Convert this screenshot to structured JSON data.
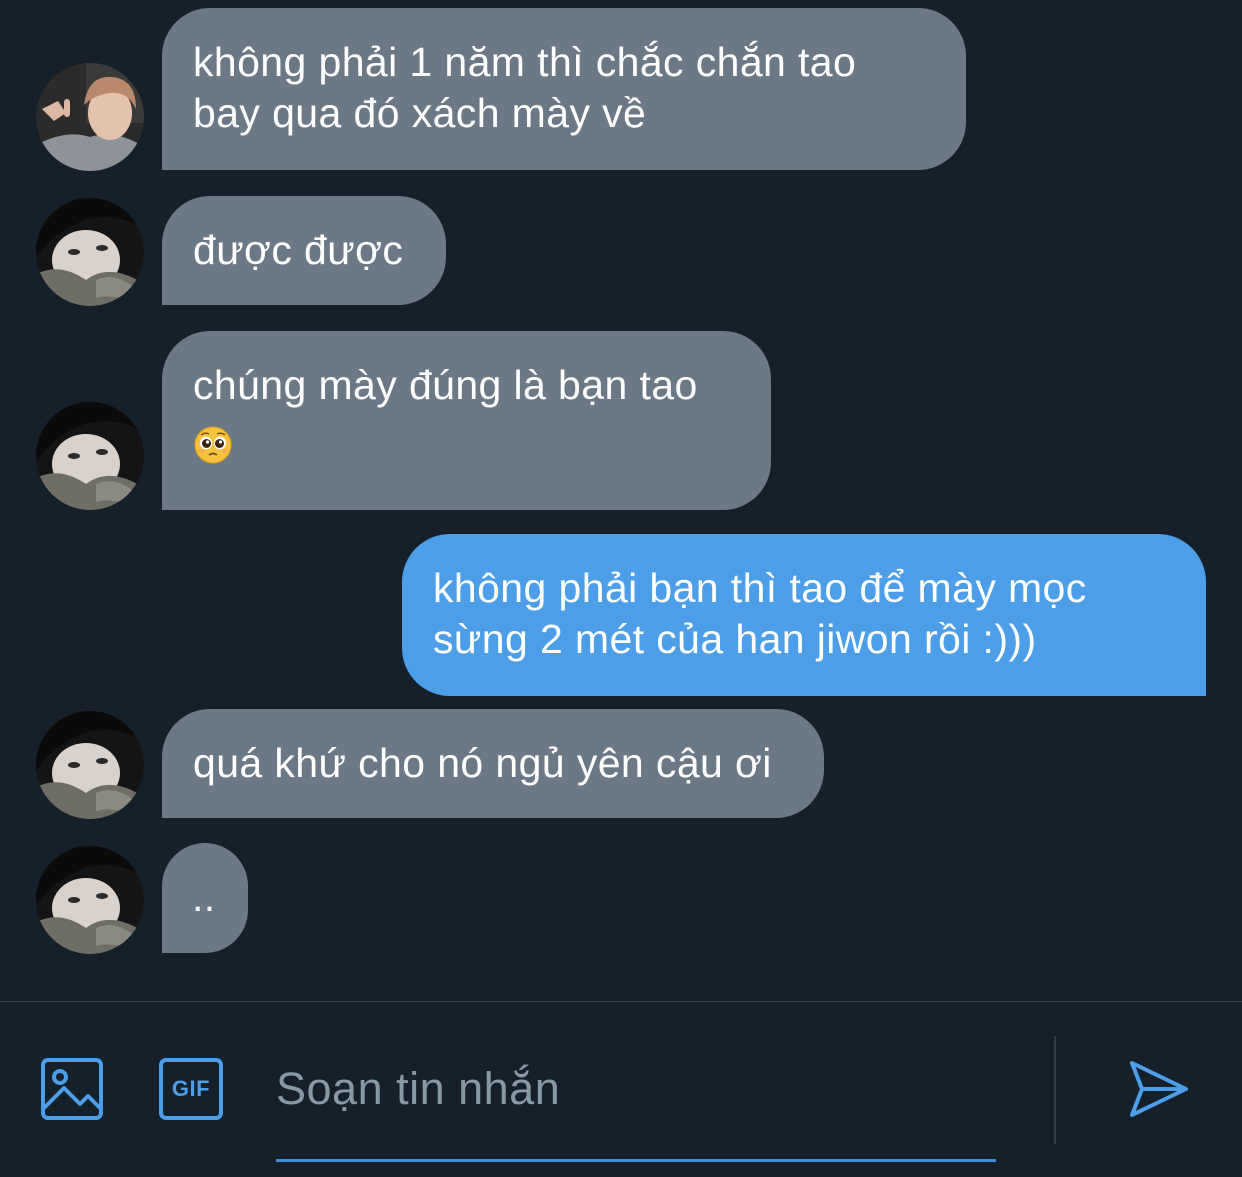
{
  "colors": {
    "background": "#15202b",
    "incoming_bubble": "#6b7885",
    "outgoing_bubble": "#4c9ee8",
    "accent": "#4c9ee8",
    "placeholder": "#8899a6"
  },
  "messages": [
    {
      "sender": "other",
      "avatar": "avatar-light-hair",
      "lines": [
        "không phải 1 năm thì chắc chắn tao",
        "bay qua đó xách mày về"
      ]
    },
    {
      "sender": "other",
      "avatar": "avatar-dark-hair",
      "lines": [
        "được được"
      ]
    },
    {
      "sender": "other",
      "avatar": "avatar-dark-hair",
      "lines": [
        "chúng mày đúng là bạn tao"
      ],
      "emoji": "pleading-face-emoji"
    },
    {
      "sender": "me",
      "lines": [
        "không phải bạn thì tao để mày mọc",
        "sừng 2 mét của han jiwon rồi :)))"
      ]
    },
    {
      "sender": "other",
      "avatar": "avatar-dark-hair",
      "lines": [
        "quá khứ cho nó ngủ yên cậu ơi"
      ]
    },
    {
      "sender": "other",
      "avatar": "avatar-dark-hair",
      "lines": [
        ".."
      ]
    }
  ],
  "composer": {
    "placeholder": "Soạn tin nhắn",
    "value": "",
    "image_icon": "image-icon",
    "gif_label": "GIF",
    "send_icon": "send-icon"
  }
}
